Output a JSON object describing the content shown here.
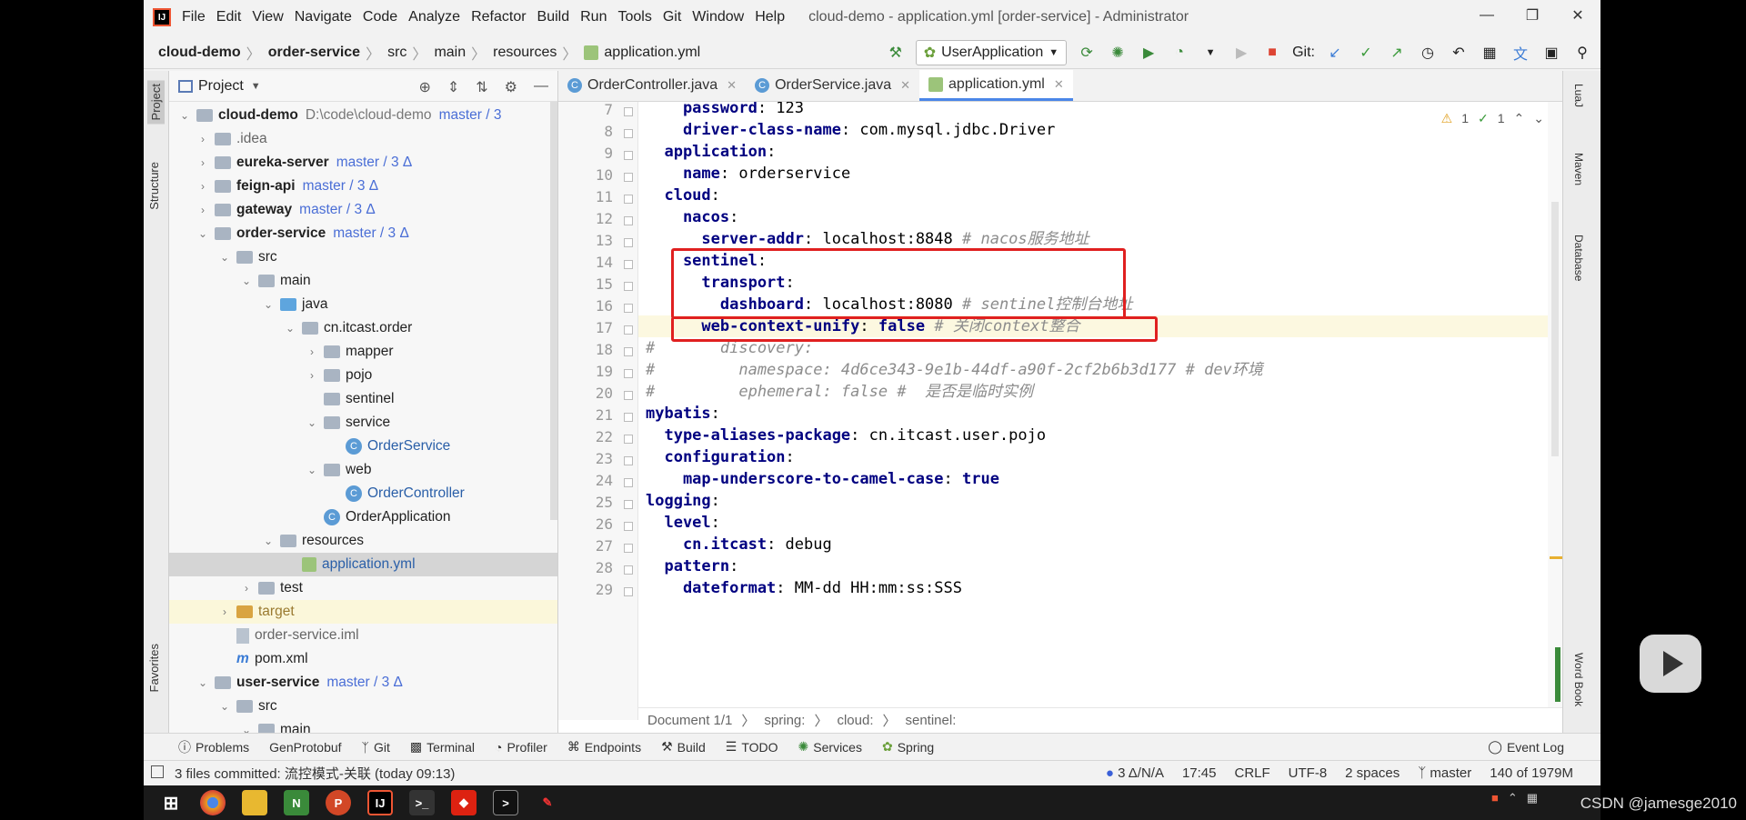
{
  "window": {
    "title": "cloud-demo - application.yml [order-service] - Administrator",
    "menu": [
      "File",
      "Edit",
      "View",
      "Navigate",
      "Code",
      "Analyze",
      "Refactor",
      "Build",
      "Run",
      "Tools",
      "Git",
      "Window",
      "Help"
    ]
  },
  "breadcrumb": [
    "cloud-demo",
    "order-service",
    "src",
    "main",
    "resources",
    "application.yml"
  ],
  "toolbar": {
    "run_config": "UserApplication",
    "git_label": "Git:"
  },
  "left_stripe": {
    "project": "Project",
    "structure": "Structure",
    "favorites": "Favorites"
  },
  "project_panel": {
    "title": "Project",
    "rows": [
      {
        "label": "cloud-demo",
        "path": "D:\\code\\cloud-demo",
        "branch": "master / 3"
      },
      {
        "label": ".idea"
      },
      {
        "label": "eureka-server",
        "branch": "master / 3 Δ"
      },
      {
        "label": "feign-api",
        "branch": "master / 3 Δ"
      },
      {
        "label": "gateway",
        "branch": "master / 3 Δ"
      },
      {
        "label": "order-service",
        "branch": "master / 3 Δ"
      },
      {
        "label": "src"
      },
      {
        "label": "main"
      },
      {
        "label": "java"
      },
      {
        "label": "cn.itcast.order"
      },
      {
        "label": "mapper"
      },
      {
        "label": "pojo"
      },
      {
        "label": "sentinel"
      },
      {
        "label": "service"
      },
      {
        "label": "OrderService"
      },
      {
        "label": "web"
      },
      {
        "label": "OrderController"
      },
      {
        "label": "OrderApplication"
      },
      {
        "label": "resources"
      },
      {
        "label": "application.yml"
      },
      {
        "label": "test"
      },
      {
        "label": "target"
      },
      {
        "label": "order-service.iml"
      },
      {
        "label": "pom.xml"
      },
      {
        "label": "user-service",
        "branch": "master / 3 Δ"
      },
      {
        "label": "src"
      },
      {
        "label": "main"
      }
    ]
  },
  "tabs": [
    {
      "label": "OrderController.java"
    },
    {
      "label": "OrderService.java"
    },
    {
      "label": "application.yml"
    }
  ],
  "inspections": {
    "warnings": "1",
    "ok": "1"
  },
  "code": {
    "lines": [
      {
        "n": "7",
        "t": [
          {
            "k": "    password"
          },
          {
            "v": ": 123"
          }
        ]
      },
      {
        "n": "8",
        "t": [
          {
            "k": "    driver-class-name"
          },
          {
            "v": ": com.mysql.jdbc.Driver"
          }
        ]
      },
      {
        "n": "9",
        "t": [
          {
            "k": "  application"
          },
          {
            "v": ":"
          }
        ]
      },
      {
        "n": "10",
        "t": [
          {
            "k": "    name"
          },
          {
            "v": ": orderservice"
          }
        ]
      },
      {
        "n": "11",
        "t": [
          {
            "k": "  cloud"
          },
          {
            "v": ":"
          }
        ]
      },
      {
        "n": "12",
        "t": [
          {
            "k": "    nacos"
          },
          {
            "v": ":"
          }
        ]
      },
      {
        "n": "13",
        "t": [
          {
            "k": "      server-addr"
          },
          {
            "v": ": localhost:8848 "
          },
          {
            "c": "# nacos服务地址"
          }
        ]
      },
      {
        "n": "14",
        "t": [
          {
            "k": "    sentinel"
          },
          {
            "v": ":"
          }
        ]
      },
      {
        "n": "15",
        "t": [
          {
            "k": "      transport"
          },
          {
            "v": ":"
          }
        ]
      },
      {
        "n": "16",
        "t": [
          {
            "k": "        dashboard"
          },
          {
            "v": ": localhost:8080 "
          },
          {
            "c": "# sentinel控制台地址"
          }
        ]
      },
      {
        "n": "17",
        "t": [
          {
            "k": "      web-context-unify"
          },
          {
            "v": ": "
          },
          {
            "b": "false"
          },
          {
            "v": " "
          },
          {
            "c": "# 关闭context整合"
          }
        ]
      },
      {
        "n": "18",
        "t": [
          {
            "c": "#       discovery:"
          }
        ]
      },
      {
        "n": "19",
        "t": [
          {
            "c": "#         namespace: 4d6ce343-9e1b-44df-a90f-2cf2b6b3d177 # dev环境"
          }
        ]
      },
      {
        "n": "20",
        "t": [
          {
            "c": "#         ephemeral: false #  是否是临时实例"
          }
        ]
      },
      {
        "n": "21",
        "t": [
          {
            "k": "mybatis"
          },
          {
            "v": ":"
          }
        ]
      },
      {
        "n": "22",
        "t": [
          {
            "k": "  type-aliases-package"
          },
          {
            "v": ": cn.itcast.user.pojo"
          }
        ]
      },
      {
        "n": "23",
        "t": [
          {
            "k": "  configuration"
          },
          {
            "v": ":"
          }
        ]
      },
      {
        "n": "24",
        "t": [
          {
            "k": "    map-underscore-to-camel-case"
          },
          {
            "v": ": "
          },
          {
            "b": "true"
          }
        ]
      },
      {
        "n": "25",
        "t": [
          {
            "k": "logging"
          },
          {
            "v": ":"
          }
        ]
      },
      {
        "n": "26",
        "t": [
          {
            "k": "  level"
          },
          {
            "v": ":"
          }
        ]
      },
      {
        "n": "27",
        "t": [
          {
            "k": "    cn.itcast"
          },
          {
            "v": ": debug"
          }
        ]
      },
      {
        "n": "28",
        "t": [
          {
            "k": "  pattern"
          },
          {
            "v": ":"
          }
        ]
      },
      {
        "n": "29",
        "t": [
          {
            "k": "    dateformat"
          },
          {
            "v": ": MM-dd HH:mm:ss:SSS"
          }
        ]
      }
    ]
  },
  "editor_breadcrumb": [
    "Document 1/1",
    "spring:",
    "cloud:",
    "sentinel:"
  ],
  "right_stripe": [
    "LuaJ",
    "Maven",
    "Database",
    "Word Book"
  ],
  "tool_tabs": [
    "Problems",
    "GenProtobuf",
    "Git",
    "Terminal",
    "Profiler",
    "Endpoints",
    "Build",
    "TODO",
    "Services",
    "Spring"
  ],
  "event_log": "Event Log",
  "status": {
    "message": "3 files committed: 流控模式-关联 (today 09:13)",
    "vcs": "3 Δ/N/A",
    "position": "17:45",
    "line_sep": "CRLF",
    "encoding": "UTF-8",
    "indent": "2 spaces",
    "branch": "master",
    "memory": "140 of 1979M"
  },
  "credit": "CSDN @jamesge2010",
  "colors": {
    "accent": "#4a86e8",
    "highlight_box": "#e02020"
  }
}
